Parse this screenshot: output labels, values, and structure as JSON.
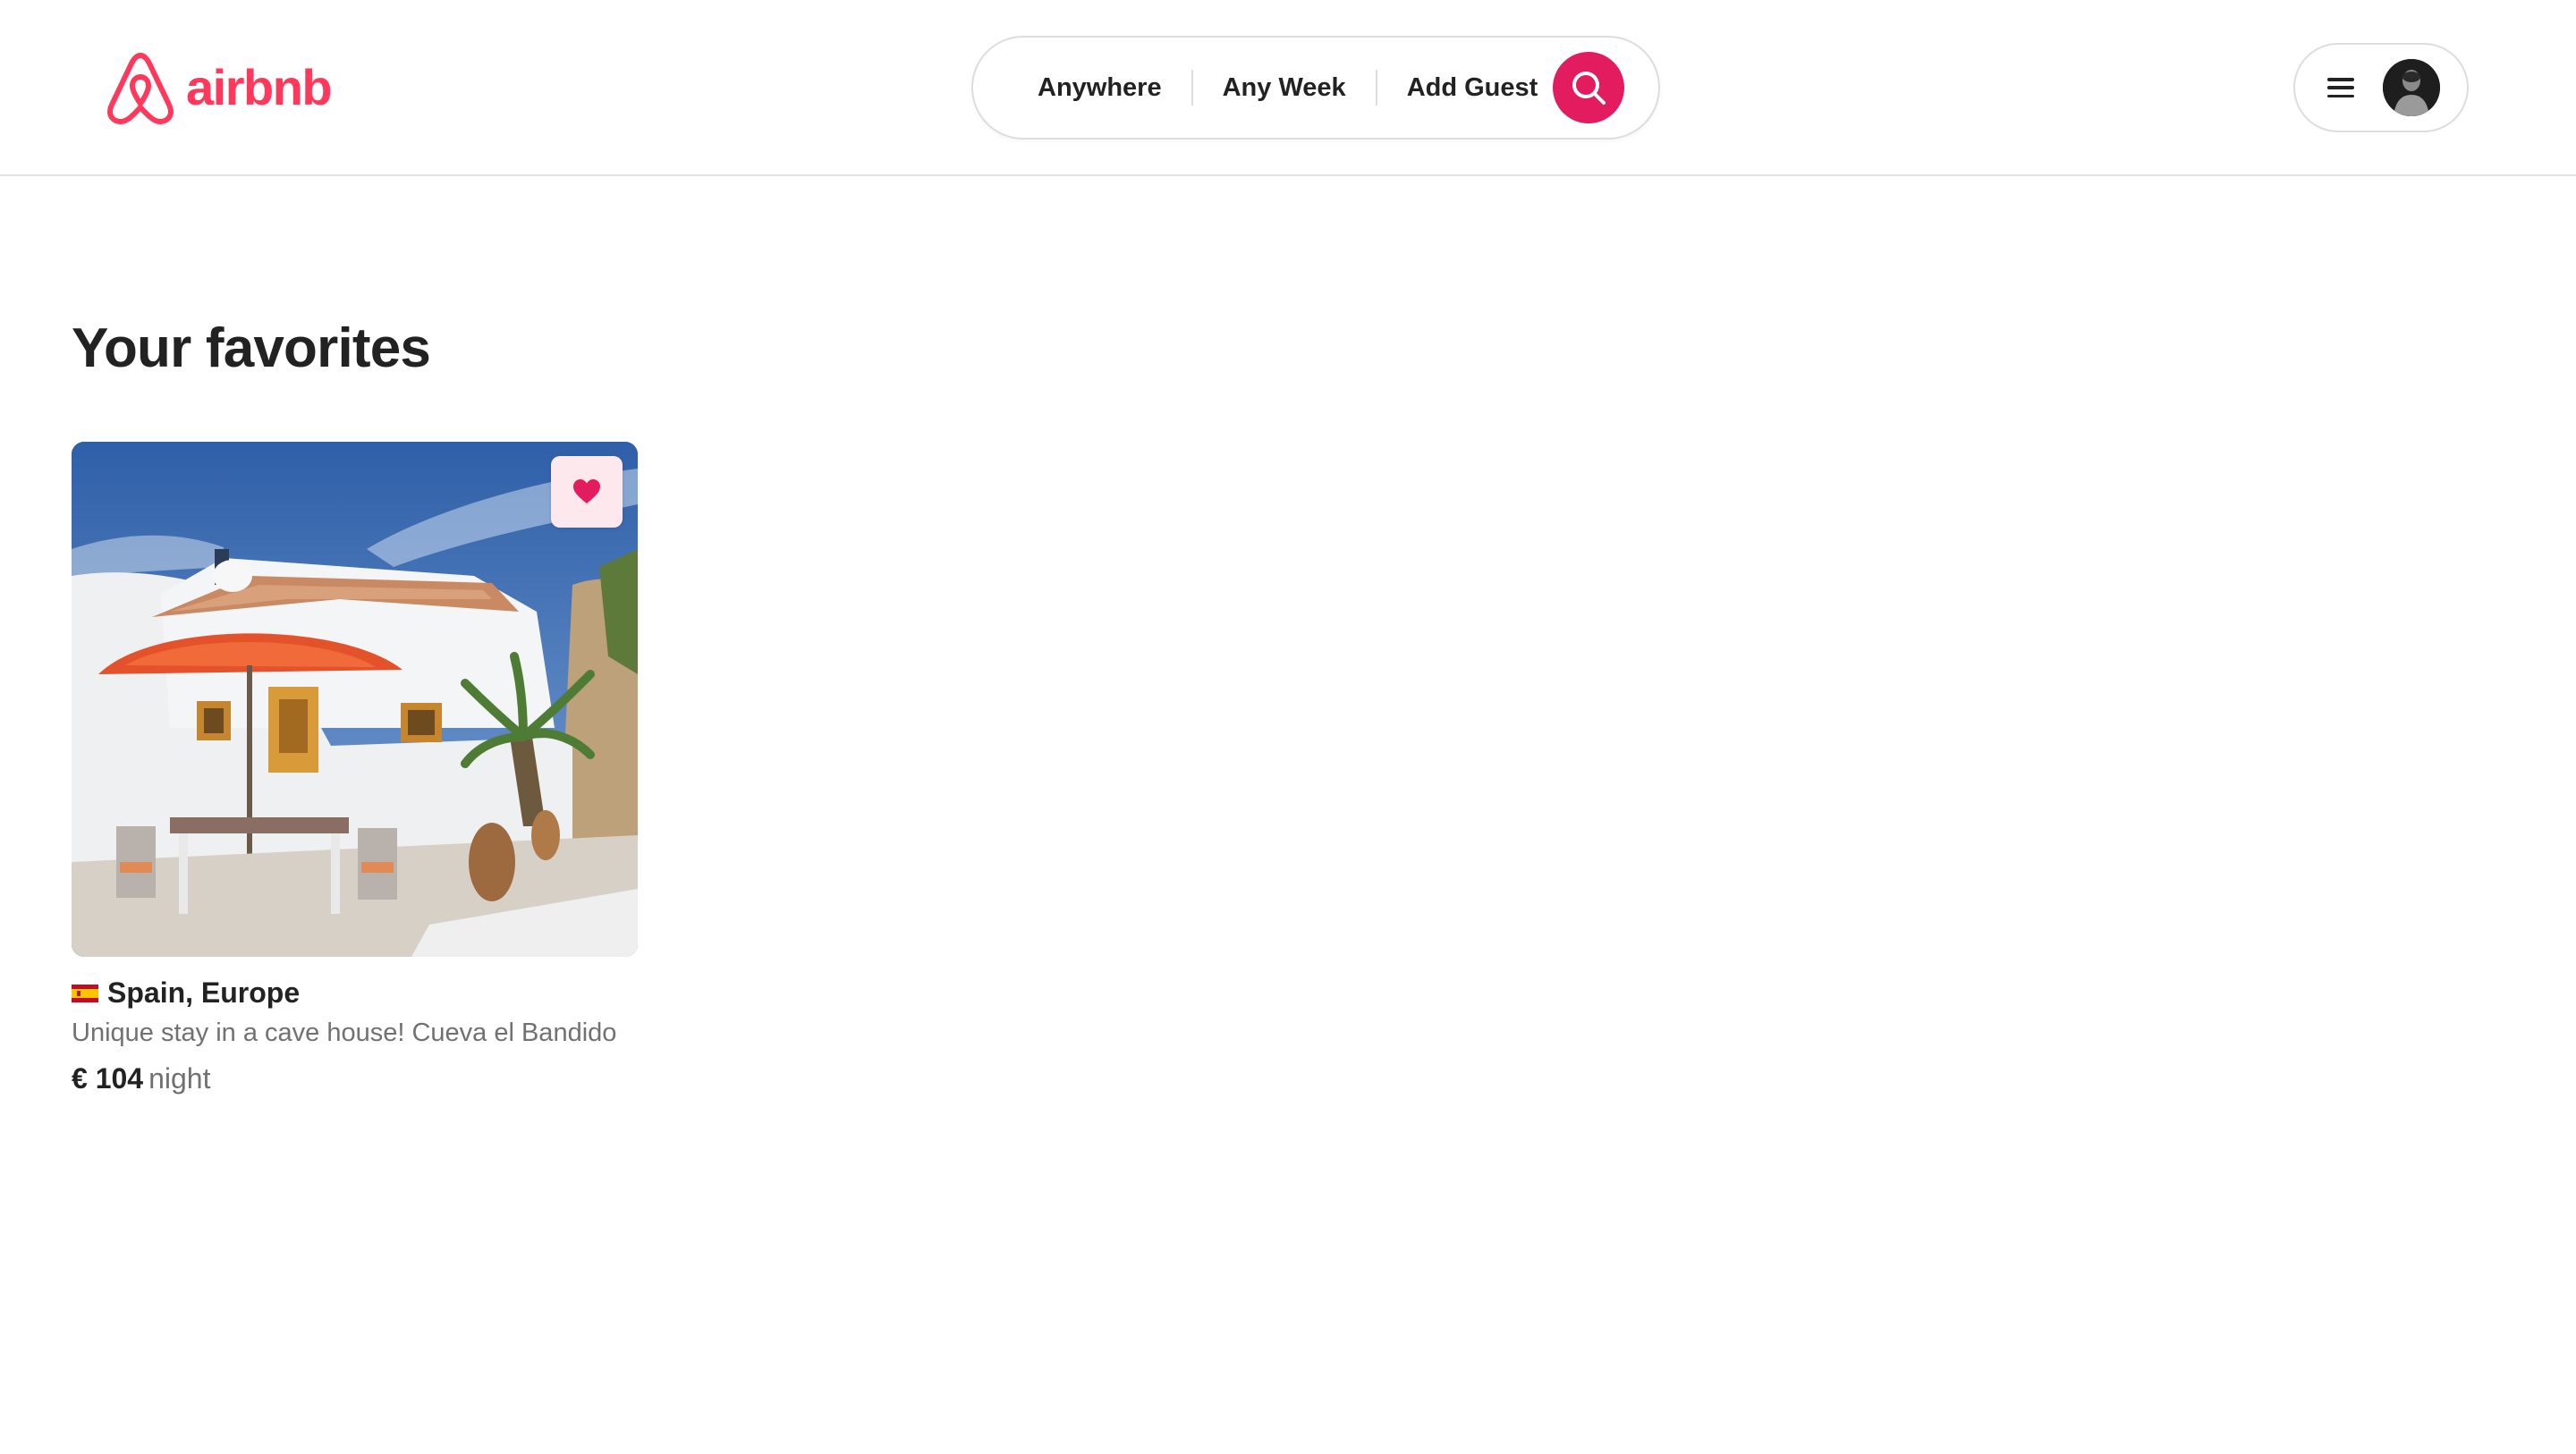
{
  "brand": {
    "name": "airbnb",
    "color": "#ff385c"
  },
  "search": {
    "where": "Anywhere",
    "when": "Any Week",
    "who": "Add Guest",
    "button_icon": "search-icon",
    "button_color": "#e31c5f"
  },
  "user_menu": {
    "menu_icon": "hamburger-menu-icon",
    "avatar_icon": "user-avatar"
  },
  "page": {
    "title": "Your favorites"
  },
  "favorites": [
    {
      "flag_icon": "spain-flag-icon",
      "location": "Spain, Europe",
      "description": "Unique stay in a cave house! Cueva el Bandido",
      "price": "€ 104",
      "price_unit": "night",
      "favorited": true,
      "heart_color": "#e31c5f"
    }
  ]
}
